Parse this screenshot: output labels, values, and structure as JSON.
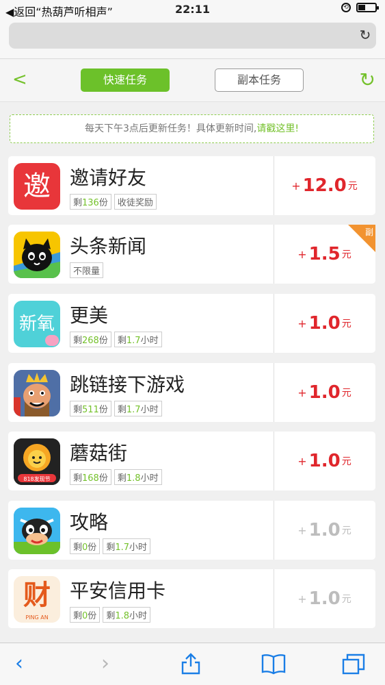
{
  "status": {
    "back_label": "◀返回“热葫芦听相声”",
    "time": "22:11"
  },
  "nav": {
    "back": "<",
    "tab_fast": "快速任务",
    "tab_dungeon": "副本任务"
  },
  "notice": {
    "text": "每天下午3点后更新任务！具体更新时间,",
    "link": "请戳这里!"
  },
  "tasks": [
    {
      "title": "邀请好友",
      "tag1_pre": "剩",
      "tag1_num": "136",
      "tag1_suf": "份",
      "tag2": "收徒奖励",
      "amount": "12.0",
      "unit": "元",
      "active": true
    },
    {
      "title": "头条新闻",
      "tag1": "不限量",
      "amount": "1.5",
      "unit": "元",
      "active": true,
      "ribbon": "副"
    },
    {
      "title": "更美",
      "tag1_pre": "剩",
      "tag1_num": "268",
      "tag1_suf": "份",
      "tag2_pre": "剩",
      "tag2_num": "1.7",
      "tag2_suf": "小时",
      "amount": "1.0",
      "unit": "元",
      "active": true
    },
    {
      "title": "跳链接下游戏",
      "tag1_pre": "剩",
      "tag1_num": "511",
      "tag1_suf": "份",
      "tag2_pre": "剩",
      "tag2_num": "1.7",
      "tag2_suf": "小时",
      "amount": "1.0",
      "unit": "元",
      "active": true
    },
    {
      "title": "蘑菇街",
      "tag1_pre": "剩",
      "tag1_num": "168",
      "tag1_suf": "份",
      "tag2_pre": "剩",
      "tag2_num": "1.8",
      "tag2_suf": "小时",
      "amount": "1.0",
      "unit": "元",
      "active": true
    },
    {
      "title": "攻略",
      "tag1_pre": "剩",
      "tag1_num": "0",
      "tag1_suf": "份",
      "tag2_pre": "剩",
      "tag2_num": "1.7",
      "tag2_suf": "小时",
      "amount": "1.0",
      "unit": "元",
      "active": false
    },
    {
      "title": "平安信用卡",
      "tag1_pre": "剩",
      "tag1_num": "0",
      "tag1_suf": "份",
      "tag2_pre": "剩",
      "tag2_num": "1.8",
      "tag2_suf": "小时",
      "amount": "1.0",
      "unit": "元",
      "active": false
    }
  ],
  "icons": {
    "invite": "邀",
    "xinyang": "新氧",
    "mogu": "818发现节",
    "pingan": "财",
    "pingan_sub": "PING AN"
  },
  "colors": {
    "green": "#6cc12a",
    "red": "#e0262c",
    "grey": "#bdbdbd",
    "orange": "#f29330"
  }
}
